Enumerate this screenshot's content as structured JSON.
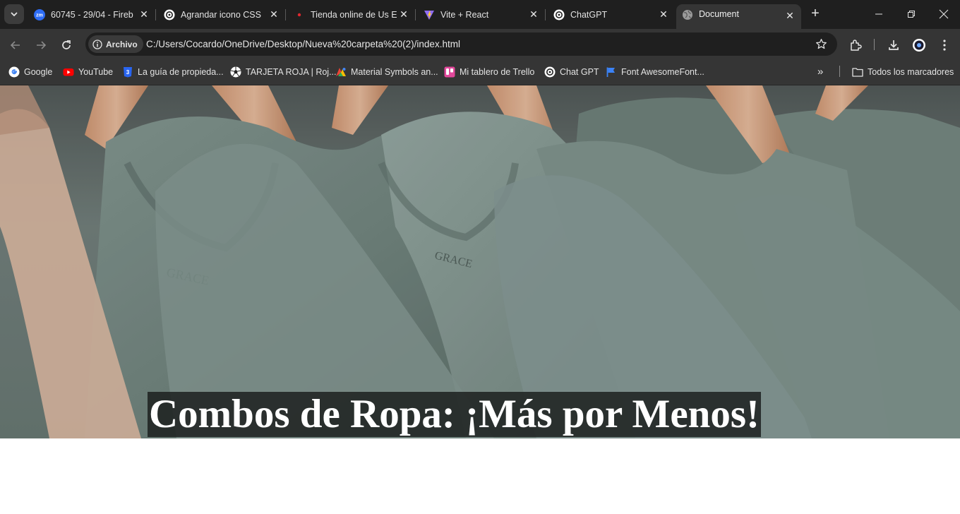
{
  "browser": {
    "tabs": [
      {
        "title": "60745 - 29/04 - Fireb",
        "icon": "zoom-icon"
      },
      {
        "title": "Agrandar icono CSS",
        "icon": "chatgpt-icon"
      },
      {
        "title": "Tienda online de Us E",
        "icon": "red-dot-icon"
      },
      {
        "title": "Vite + React",
        "icon": "vite-icon"
      },
      {
        "title": "ChatGPT",
        "icon": "chatgpt-icon"
      },
      {
        "title": "Document",
        "icon": "globe-icon",
        "active": true
      }
    ],
    "address": {
      "chip_label": "Archivo",
      "url": "C:/Users/Cocardo/OneDrive/Desktop/Nueva%20carpeta%20(2)/index.html"
    },
    "bookmarks": [
      {
        "label": "Google",
        "icon": "google-icon"
      },
      {
        "label": "YouTube",
        "icon": "youtube-icon"
      },
      {
        "label": "La guía de propieda...",
        "icon": "css3-icon"
      },
      {
        "label": "TARJETA ROJA | Roj...",
        "icon": "soccer-ball-icon"
      },
      {
        "label": "Material Symbols an...",
        "icon": "material-icon"
      },
      {
        "label": "Mi tablero de Trello",
        "icon": "trello-icon"
      },
      {
        "label": "Chat GPT",
        "icon": "chatgpt-icon"
      },
      {
        "label": "Font AwesomeFont...",
        "icon": "flag-icon"
      }
    ],
    "all_bookmarks_label": "Todos los marcadores"
  },
  "page": {
    "hero_title": "Combos de Ropa: ¡Más por Menos!"
  }
}
